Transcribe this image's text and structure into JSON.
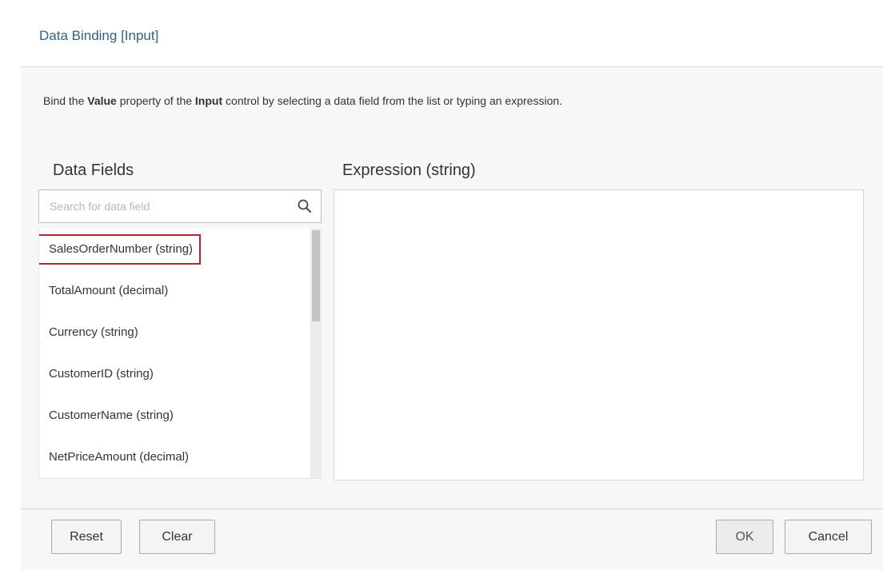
{
  "dialog": {
    "title": "Data Binding [Input]"
  },
  "instructions": {
    "part1": "Bind the ",
    "bold1": "Value",
    "part2": " property of the ",
    "bold2": "Input",
    "part3": " control by selecting a data field from the list or typing an expression."
  },
  "data_fields": {
    "heading": "Data Fields",
    "search_placeholder": "Search for data field",
    "search_value": "",
    "items": [
      {
        "label": "SalesOrderNumber (string)",
        "selected": true
      },
      {
        "label": "TotalAmount (decimal)",
        "selected": false
      },
      {
        "label": "Currency (string)",
        "selected": false
      },
      {
        "label": "CustomerID (string)",
        "selected": false
      },
      {
        "label": "CustomerName (string)",
        "selected": false
      },
      {
        "label": "NetPriceAmount (decimal)",
        "selected": false
      }
    ],
    "scroll_fraction": 0.0
  },
  "expression": {
    "heading": "Expression (string)",
    "value": ""
  },
  "footer": {
    "reset_label": "Reset",
    "clear_label": "Clear",
    "ok_label": "OK",
    "cancel_label": "Cancel"
  },
  "icons": {
    "search": "search-icon"
  },
  "colors": {
    "title": "#346187",
    "selection_outline": "#b3262f"
  }
}
